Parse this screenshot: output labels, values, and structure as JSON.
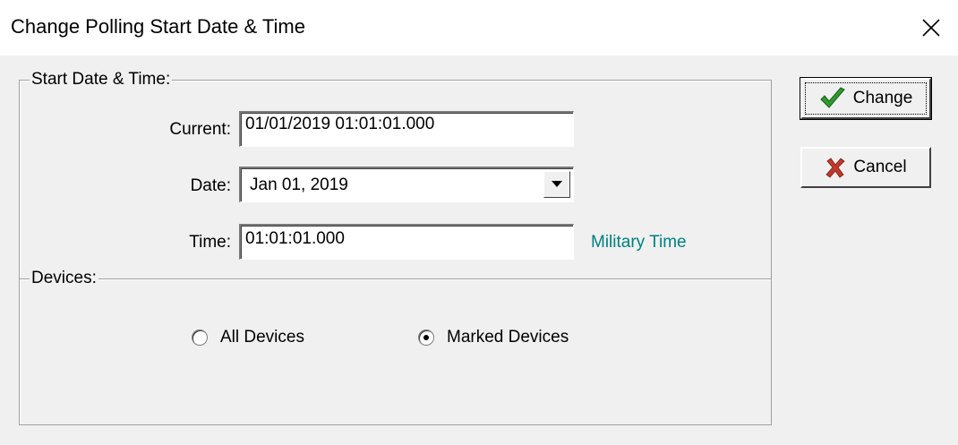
{
  "window": {
    "title": "Change Polling Start Date & Time"
  },
  "start_group": {
    "legend": "Start Date & Time:",
    "current_label": "Current:",
    "current_value": "01/01/2019 01:01:01.000",
    "date_label": "Date:",
    "date_value": "Jan 01, 2019",
    "time_label": "Time:",
    "time_value": "01:01:01.000",
    "time_hint": "Military Time"
  },
  "devices_group": {
    "legend": "Devices:",
    "options": [
      {
        "label": "All Devices",
        "selected": false
      },
      {
        "label": "Marked Devices",
        "selected": true
      }
    ]
  },
  "buttons": {
    "change_label": "Change",
    "cancel_label": "Cancel"
  },
  "icons": {
    "close": "close-icon",
    "change": "checkmark-icon",
    "cancel": "x-icon",
    "dropdown": "dropdown-arrow-icon"
  },
  "colors": {
    "hint": "#008080",
    "check": "#2e9b2e",
    "cancel_x": "#c0392b"
  }
}
